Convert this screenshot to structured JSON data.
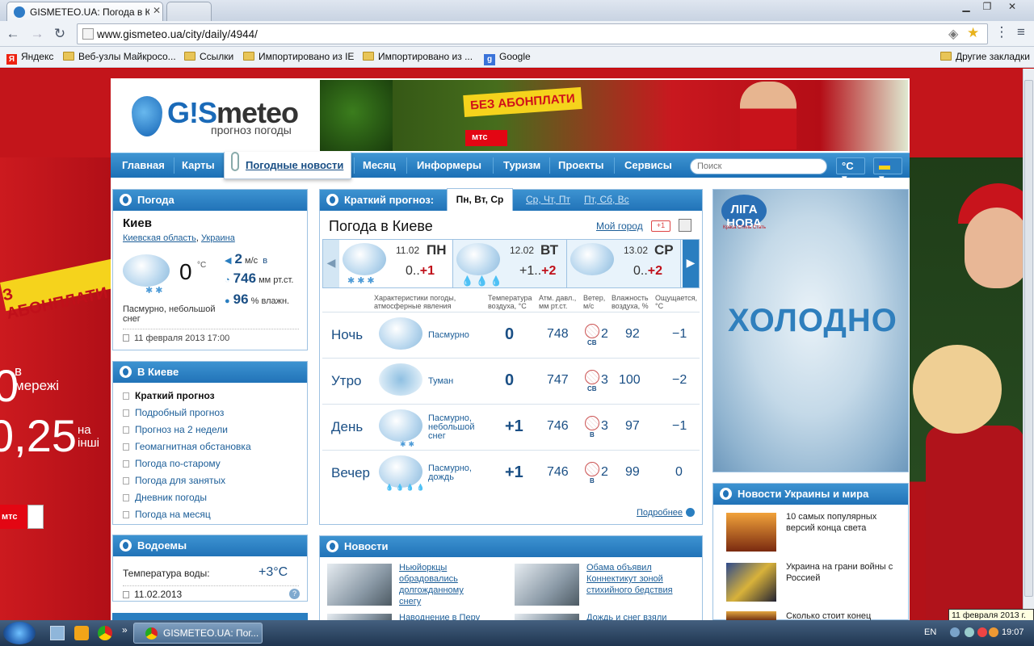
{
  "browser": {
    "tab_title": "GISMETEO.UA: Погода в Ки",
    "url": "www.gismeteo.ua/city/daily/4944/",
    "bookmarks": [
      "Яндекс",
      "Веб-узлы Майкросо...",
      "Ссылки",
      "Импортировано из IE",
      "Импортировано из ...",
      "Google"
    ],
    "other_bookmarks": "Другие закладки"
  },
  "ads": {
    "left_slogan": "З АБОНПЛАТИ",
    "left_big1": "0",
    "left_small1": "в\nмережі",
    "left_big2": "0,25",
    "left_small2": "на\nінші",
    "mts": "мтс",
    "banner_slogan": "БЕЗ АБОНПЛАТИ",
    "banner_mts": "мтс",
    "liga_logo": "ЛІГА НОВА",
    "liga_tag": "Краса Стиль Стать",
    "liga_text": "ХОЛОДНО"
  },
  "site": {
    "logo_name_a": "G!S",
    "logo_name_b": "meteo",
    "logo_sub": "прогноз погоды",
    "nav": [
      "Главная",
      "Карты",
      "Погодные новости",
      "Месяц",
      "Информеры",
      "Туризм",
      "Проекты",
      "Сервисы"
    ],
    "search_placeholder": "Поиск",
    "unit": "°C"
  },
  "weather": {
    "title": "Погода",
    "city": "Киев",
    "region": "Киевская область",
    "country": "Украина",
    "temp": "0",
    "temp_unit": "°C",
    "wind": "2",
    "wind_unit": "м/с",
    "wind_dir": "в",
    "pressure": "746",
    "pressure_unit": "мм рт.ст.",
    "humidity": "96",
    "humidity_unit": "% влажн.",
    "desc": "Пасмурно, небольшой снег",
    "date": "11 февраля 2013 17:00"
  },
  "kiev": {
    "title": "В Киеве",
    "items": [
      "Краткий прогноз",
      "Подробный прогноз",
      "Прогноз на 2 недели",
      "Геомагнитная обстановка",
      "Погода по-старому",
      "Погода для занятых",
      "Дневник погоды",
      "Погода на месяц"
    ]
  },
  "water": {
    "title": "Водоемы",
    "label": "Температура воды:",
    "value": "+3°C",
    "date": "11.02.2013",
    "help": "?"
  },
  "forecast": {
    "title": "Краткий прогноз:",
    "tabs": [
      "Пн, Вт, Ср",
      "Ср, Чт, Пт",
      "Пт, Сб, Вс"
    ],
    "heading": "Погода в Киеве",
    "my_city": "Мой город",
    "gplus": "+1",
    "days": [
      {
        "date": "11.02",
        "wd": "ПН",
        "t1": "0..",
        "t2": "+1"
      },
      {
        "date": "12.02",
        "wd": "ВТ",
        "t1": "+1..",
        "t2": "+2"
      },
      {
        "date": "13.02",
        "wd": "СР",
        "t1": "0..",
        "t2": "+2"
      }
    ],
    "col_headers": [
      "Характеристики погоды,\nатмосферные явления",
      "Температура\nвоздуха, °С",
      "Атм. давл.,\nмм рт.ст.",
      "Ветер,\nм/с",
      "Влажность\nвоздуха, %",
      "Ощущается,\n°С"
    ],
    "rows": [
      {
        "name": "Ночь",
        "desc": "Пасмурно",
        "t": "0",
        "p": "748",
        "dir": "СВ",
        "w": "2",
        "h": "92",
        "f": "−1"
      },
      {
        "name": "Утро",
        "desc": "Туман",
        "t": "0",
        "p": "747",
        "dir": "СВ",
        "w": "3",
        "h": "100",
        "f": "−2"
      },
      {
        "name": "День",
        "desc": "Пасмурно,\nнебольшой\nснег",
        "t": "+1",
        "p": "746",
        "dir": "В",
        "w": "3",
        "h": "97",
        "f": "−1"
      },
      {
        "name": "Вечер",
        "desc": "Пасмурно,\nдождь",
        "t": "+1",
        "p": "746",
        "dir": "В",
        "w": "2",
        "h": "99",
        "f": "0"
      }
    ],
    "more": "Подробнее"
  },
  "news": {
    "title": "Новости",
    "items": [
      "Ньюйоркцы обрадовались долгожданному снегу",
      "Обама объявил Коннектикут зоной стихийного бедствия",
      "Наводнение в Перу",
      "Дождь и снег взяли"
    ]
  },
  "right_news": {
    "title": "Новости Украины и мира",
    "items": [
      "10 самых популярных версий конца света",
      "Украина на грани войны с Россией",
      "Сколько стоит конец"
    ]
  },
  "tooltip": "11 февраля 2013 г.",
  "taskbar": {
    "task": "GISMETEO.UA: Пог...",
    "lang": "EN",
    "time": "19:07"
  }
}
